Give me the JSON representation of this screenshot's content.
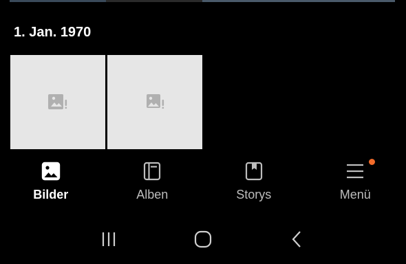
{
  "date_header": "1. Jan. 1970",
  "thumbnails": [
    {
      "icon": "broken-image-icon"
    },
    {
      "icon": "broken-image-icon"
    }
  ],
  "bottom_nav": {
    "items": [
      {
        "label": "Bilder",
        "icon": "image-icon",
        "active": true
      },
      {
        "label": "Alben",
        "icon": "album-icon",
        "active": false
      },
      {
        "label": "Storys",
        "icon": "story-icon",
        "active": false
      },
      {
        "label": "Menü",
        "icon": "menu-icon",
        "active": false,
        "badge": true
      }
    ]
  },
  "system_nav": {
    "recents": "recents-icon",
    "home": "home-icon",
    "back": "back-icon"
  },
  "colors": {
    "background": "#000000",
    "thumbnail_bg": "#e6e6e6",
    "placeholder_icon": "#b0b0b0",
    "active_label": "#ffffff",
    "inactive_label": "#bdbdbd",
    "badge": "#f26b2a"
  }
}
